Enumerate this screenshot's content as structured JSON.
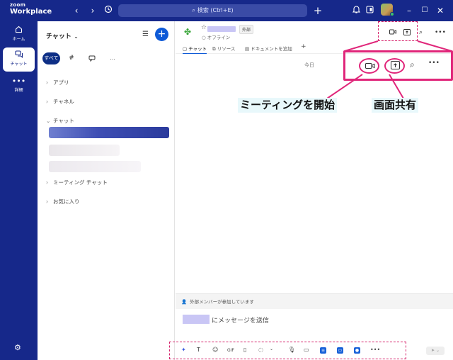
{
  "app": {
    "logo_top": "zoom",
    "logo_bottom": "Workplace"
  },
  "titlebar": {
    "search_label": "検索 (Ctrl+E)"
  },
  "leftnav": {
    "items": [
      {
        "label": "ホーム",
        "icon": "home-icon"
      },
      {
        "label": "チャット",
        "icon": "chat-icon",
        "active": true
      },
      {
        "label": "詳細",
        "icon": "more-icon"
      }
    ]
  },
  "panel": {
    "title": "チャット",
    "chips": [
      "すべて",
      "#",
      "💬",
      "…"
    ],
    "sections": [
      "アプリ",
      "チャネル",
      "チャット",
      "ミーティング チャット",
      "お気に入り"
    ]
  },
  "main": {
    "external_badge": "外部",
    "status": "オフライン",
    "tabs": [
      "チャット",
      "リソース",
      "ドキュメントを追加"
    ],
    "date_divider": "今日",
    "external_notice": "外部メンバーが参加しています",
    "message_placeholder": "にメッセージを送信"
  },
  "annotations": {
    "start_meeting": "ミーティングを開始",
    "screen_share": "画面共有",
    "accent": "#e0267a"
  },
  "colors": {
    "brand": "#16288a",
    "accent_blue": "#0e5ad7"
  }
}
